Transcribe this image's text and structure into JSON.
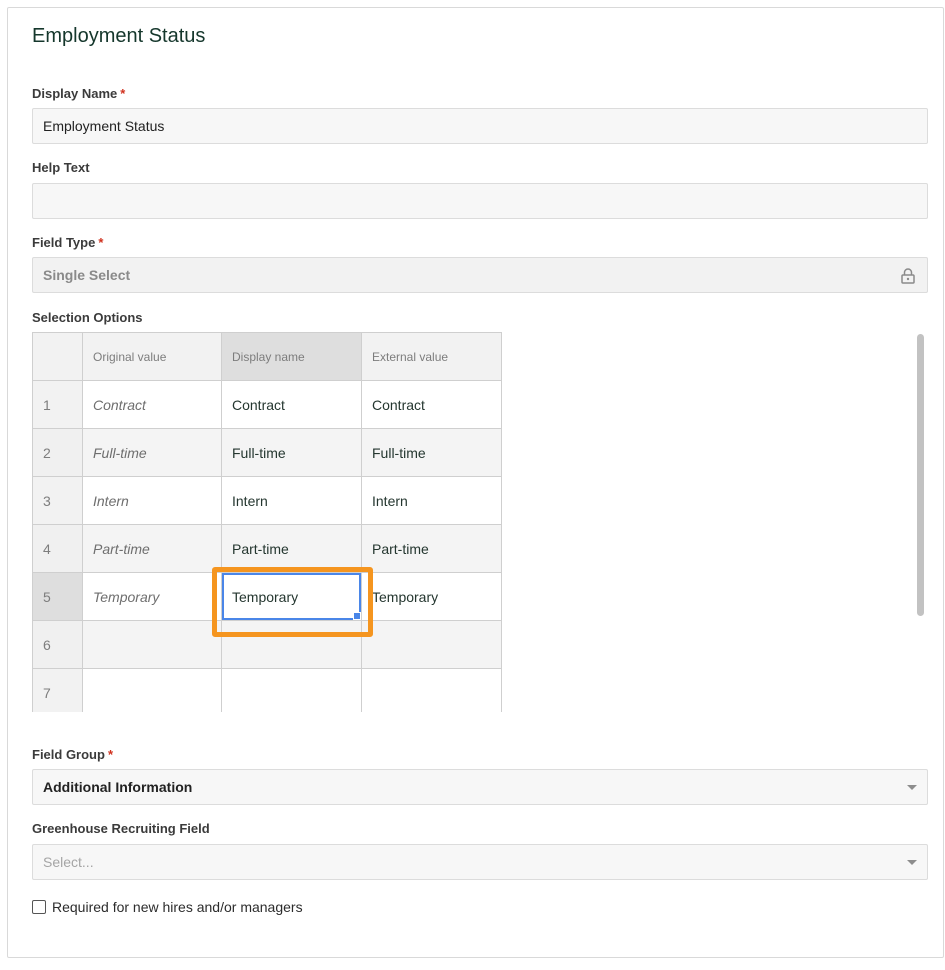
{
  "page": {
    "title": "Employment Status"
  },
  "display_name": {
    "label": "Display Name",
    "required": "*",
    "value": "Employment Status"
  },
  "help_text": {
    "label": "Help Text",
    "value": ""
  },
  "field_type": {
    "label": "Field Type",
    "required": "*",
    "value": "Single Select",
    "icon": "lock-icon"
  },
  "selection_options": {
    "label": "Selection Options",
    "columns": [
      "Original value",
      "Display name",
      "External value"
    ],
    "rows": [
      {
        "num": "1",
        "original": "Contract",
        "display": "Contract",
        "external": "Contract"
      },
      {
        "num": "2",
        "original": "Full-time",
        "display": "Full-time",
        "external": "Full-time"
      },
      {
        "num": "3",
        "original": "Intern",
        "display": "Intern",
        "external": "Intern"
      },
      {
        "num": "4",
        "original": "Part-time",
        "display": "Part-time",
        "external": "Part-time"
      },
      {
        "num": "5",
        "original": "Temporary",
        "display": "Temporary",
        "external": "Temporary"
      },
      {
        "num": "6",
        "original": "",
        "display": "",
        "external": ""
      },
      {
        "num": "7",
        "original": "",
        "display": "",
        "external": ""
      }
    ]
  },
  "field_group": {
    "label": "Field Group",
    "required": "*",
    "value": "Additional Information"
  },
  "recruiting_field": {
    "label": "Greenhouse Recruiting Field",
    "placeholder": "Select..."
  },
  "required_checkbox": {
    "label": "Required for new hires and/or managers",
    "checked": false
  },
  "colors": {
    "highlight": "#f5951f",
    "selection": "#4a86e8",
    "required": "#d0311e"
  }
}
